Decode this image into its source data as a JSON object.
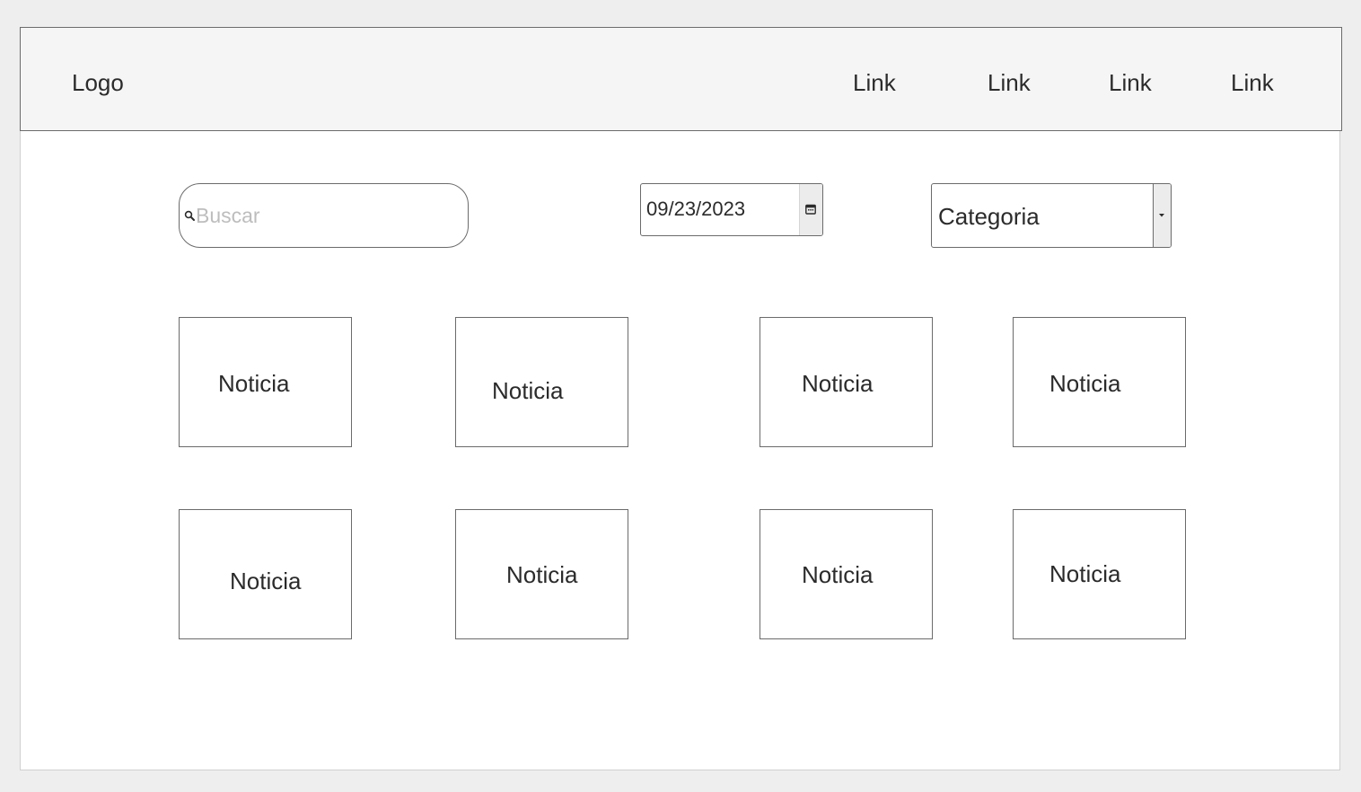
{
  "navbar": {
    "logo": "Logo",
    "links": [
      "Link",
      "Link",
      "Link",
      "Link"
    ]
  },
  "filters": {
    "search_placeholder": "Buscar",
    "search_value": "",
    "date_value": "09/23/2023",
    "category_selected": "Categoria"
  },
  "news": {
    "cards": [
      "Noticia",
      "Noticia",
      "Noticia",
      "Noticia",
      "Noticia",
      "Noticia",
      "Noticia",
      "Noticia"
    ]
  },
  "colors": {
    "background": "#eeeeee",
    "navbar": "#f5f5f5",
    "border": "#6b6b6b",
    "text": "#2b2b2b",
    "placeholder": "#bdbdbd"
  },
  "icons": {
    "search": "search-icon",
    "calendar": "calendar-icon",
    "dropdown": "chevron-down-icon"
  }
}
